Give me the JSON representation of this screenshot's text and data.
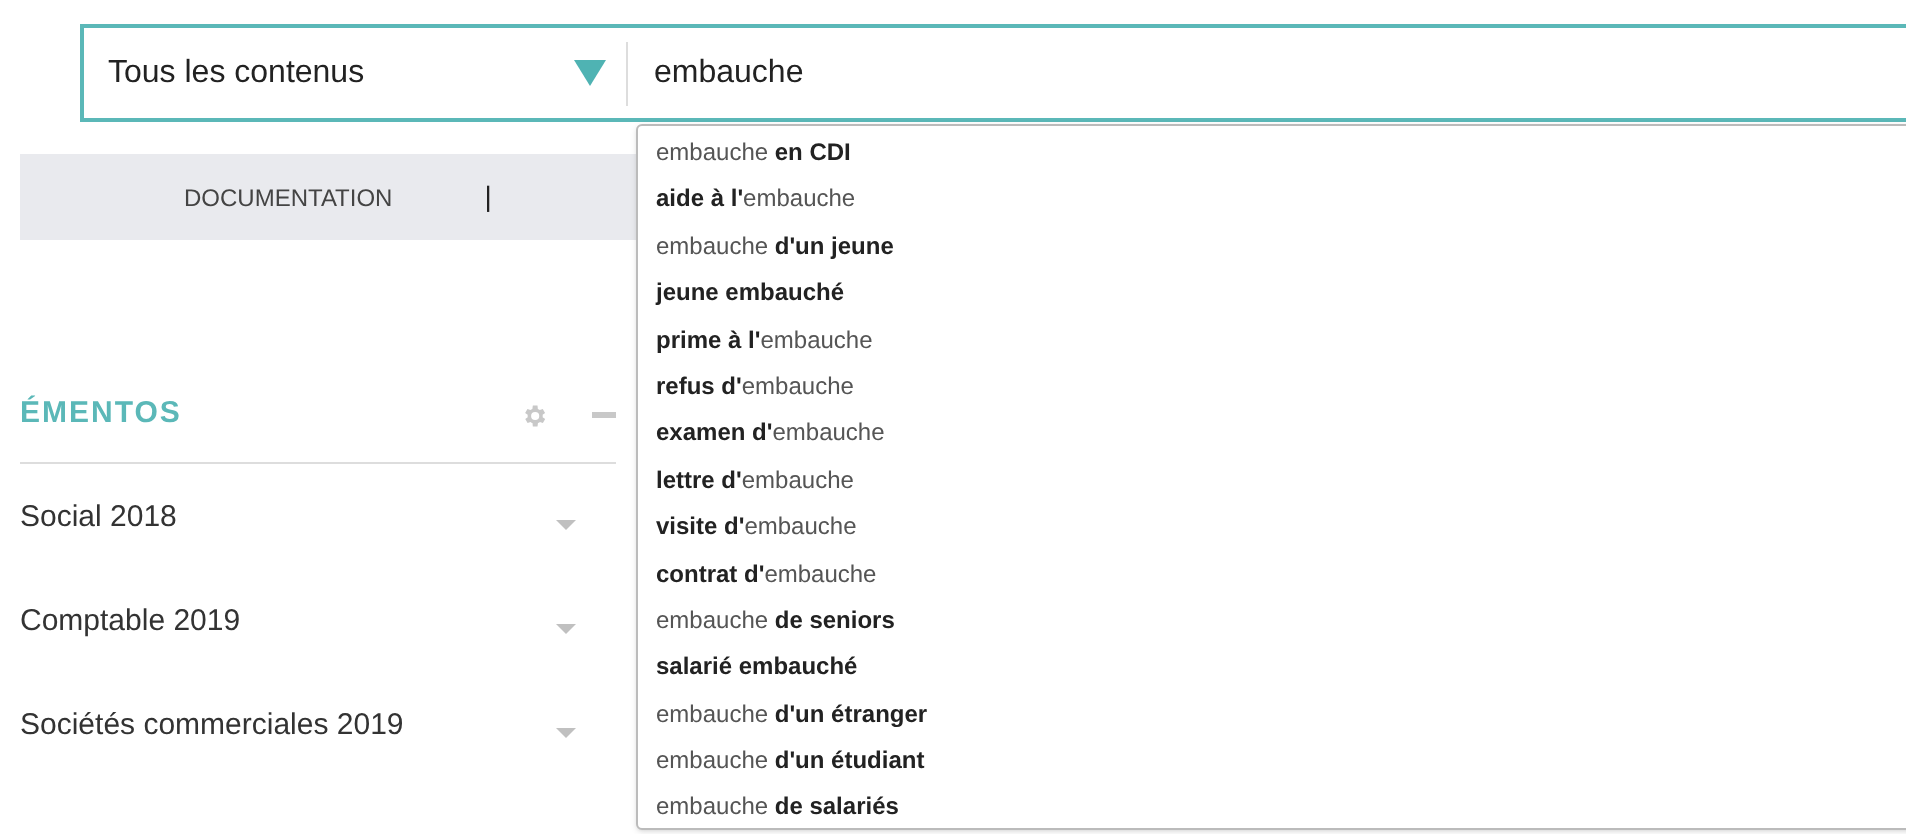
{
  "search": {
    "scope": "Tous les contenus",
    "query": "embauche"
  },
  "nav_band": {
    "label": "DOCUMENTATION",
    "separator": "|"
  },
  "sidebar": {
    "title": "ÉMENTOS",
    "items": [
      {
        "label": "Social 2018"
      },
      {
        "label": "Comptable 2019"
      },
      {
        "label": "Sociétés commerciales 2019"
      }
    ]
  },
  "suggestions": [
    "embauche **en CDI**",
    "**aide à l'**embauche",
    "embauche **d'un jeune**",
    "**jeune embauché**",
    "**prime à l'**embauche",
    "**refus d'**embauche",
    "**examen d'**embauche",
    "**lettre d'**embauche",
    "**visite d'**embauche",
    "**contrat d'**embauche",
    "embauche **de seniors**",
    "**salarié embauché**",
    "embauche **d'un étranger**",
    "embauche **d'un étudiant**",
    "embauche **de salariés**"
  ]
}
